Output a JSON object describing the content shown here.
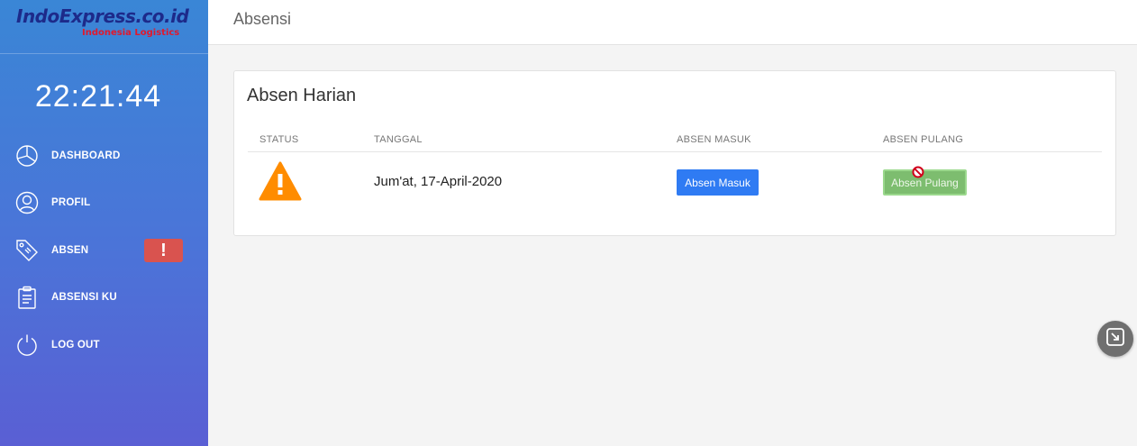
{
  "brand": {
    "name": "IndoExpress.co.id",
    "tagline": "Indonesia Logistics"
  },
  "clock": "22:21:44",
  "sidebar": {
    "items": [
      {
        "label": "DASHBOARD",
        "icon": "pie-chart-icon"
      },
      {
        "label": "PROFIL",
        "icon": "user-icon"
      },
      {
        "label": "ABSEN",
        "icon": "tag-icon",
        "badge": "!"
      },
      {
        "label": "ABSENSI KU",
        "icon": "clipboard-icon"
      },
      {
        "label": "LOG OUT",
        "icon": "power-icon"
      }
    ]
  },
  "header": {
    "title": "Absensi"
  },
  "card": {
    "title": "Absen Harian",
    "columns": [
      "STATUS",
      "TANGGAL",
      "ABSEN MASUK",
      "ABSEN PULANG"
    ],
    "row": {
      "status_icon": "warning-icon",
      "date": "Jum'at, 17-April-2020",
      "masuk_label": "Absen Masuk",
      "pulang_label": "Absen Pulang"
    }
  },
  "colors": {
    "accent": "#2f7bf3",
    "success": "#7dbd6f",
    "danger": "#d9534f",
    "warning": "#ff8c00",
    "logo": "#1d2a8a"
  }
}
